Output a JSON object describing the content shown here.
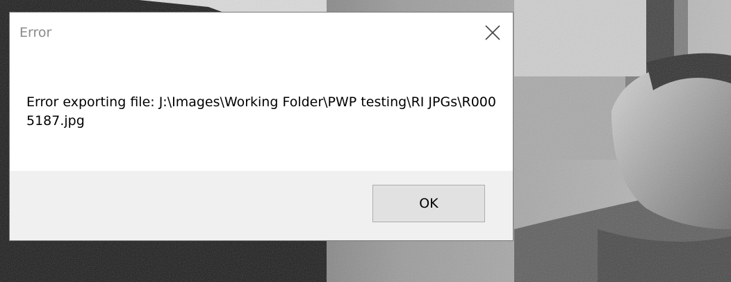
{
  "dialog": {
    "title": "Error",
    "message": "Error exporting file: J:\\Images\\Working Folder\\PWP testing\\RI JPGs\\R0005187.jpg",
    "ok_label": "OK",
    "close_icon": "close-icon"
  },
  "background": {
    "description_icon": "desktop-wallpaper"
  }
}
